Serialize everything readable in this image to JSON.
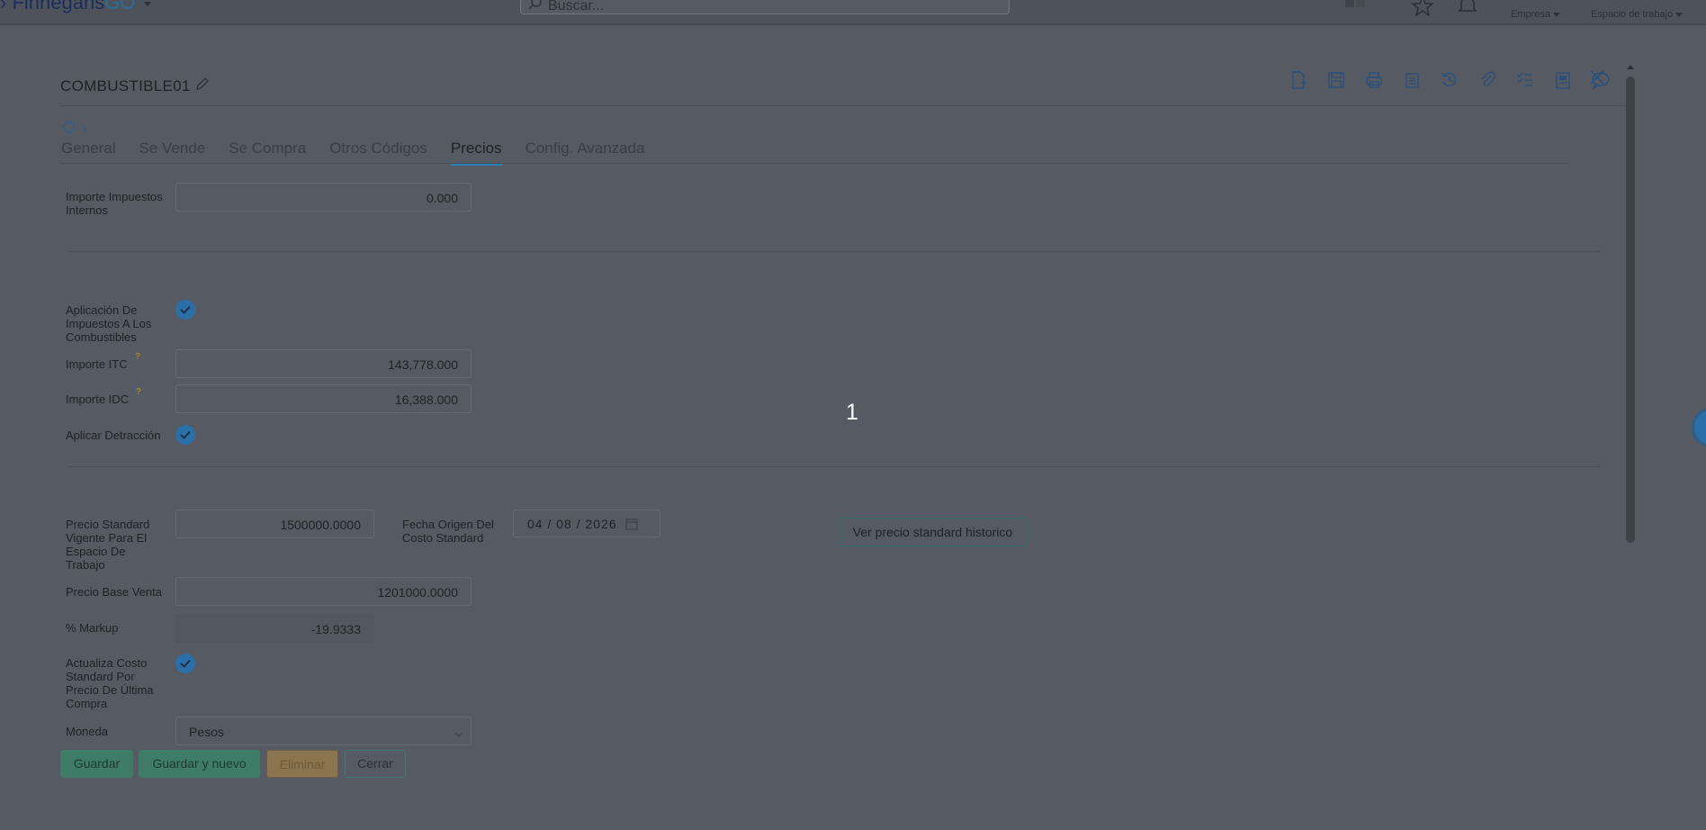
{
  "header": {
    "brand_prefix": "Finnegans",
    "brand_suffix": "GO",
    "search_placeholder": "Buscar...",
    "empresa_label": "Empresa",
    "workspace_label": "Espacio de trabajo"
  },
  "record": {
    "title": "COMBUSTIBLE01"
  },
  "tabs": [
    {
      "label": "General"
    },
    {
      "label": "Se Vende"
    },
    {
      "label": "Se Compra"
    },
    {
      "label": "Otros Códigos"
    },
    {
      "label": "Precios"
    },
    {
      "label": "Config. Avanzada"
    }
  ],
  "active_tab": "Precios",
  "fields": {
    "importe_impuestos_internos": {
      "label": "Importe Impuestos Internos",
      "value": "0.000"
    },
    "aplicacion_impuestos": {
      "label": "Aplicación De Impuestos A Los Combustibles",
      "checked": true
    },
    "importe_itc": {
      "label": "Importe ITC",
      "help": "?",
      "value": "143,778.000"
    },
    "importe_idc": {
      "label": "Importe IDC",
      "help": "?",
      "value": "16,388.000"
    },
    "aplicar_detraccion": {
      "label": "Aplicar Detracción",
      "checked": true
    },
    "precio_standard": {
      "label": "Precio Standard Vigente Para El Espacio De Trabajo",
      "value": "1500000.0000"
    },
    "fecha_origen": {
      "label": "Fecha Origen Del Costo Standard",
      "value": "04 / 08 / 2026"
    },
    "ver_historico_button": "Ver precio standard historico",
    "precio_base_venta": {
      "label": "Precio Base Venta",
      "value": "1201000.0000"
    },
    "markup": {
      "label": "% Markup",
      "value": "-19.9333"
    },
    "actualiza_costo": {
      "label": "Actualiza Costo Standard Por Precio De Última Compra",
      "checked": true
    },
    "moneda": {
      "label": "Moneda",
      "value": "Pesos"
    }
  },
  "buttons": {
    "guardar": "Guardar",
    "guardar_nuevo": "Guardar y nuevo",
    "eliminar": "Eliminar",
    "cerrar": "Cerrar"
  },
  "overlay": {
    "step_number": "1"
  },
  "colors": {
    "accent": "#2a7fb8",
    "check": "#2b6fa8",
    "save_button": "#3e7c67",
    "delete_button": "#8a7550",
    "overlay": "#555a63"
  }
}
